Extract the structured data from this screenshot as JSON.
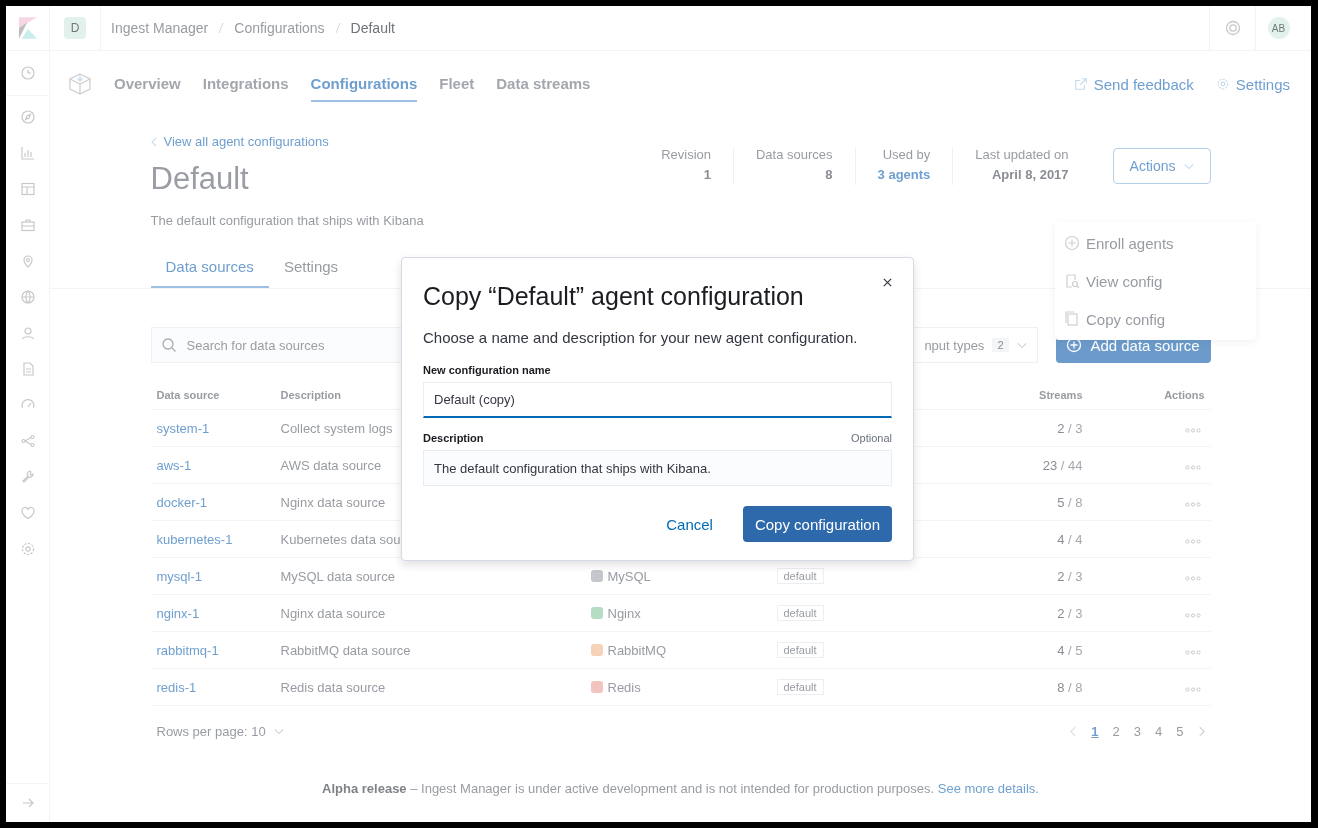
{
  "header": {
    "space_avatar": "D",
    "breadcrumbs": [
      {
        "label": "Ingest Manager",
        "selected": false
      },
      {
        "label": "Configurations",
        "selected": false
      },
      {
        "label": "Default",
        "selected": true
      }
    ],
    "user_avatar": "AB"
  },
  "app_nav": {
    "tabs": [
      {
        "label": "Overview",
        "selected": false
      },
      {
        "label": "Integrations",
        "selected": false
      },
      {
        "label": "Configurations",
        "selected": true
      },
      {
        "label": "Fleet",
        "selected": false
      },
      {
        "label": "Data streams",
        "selected": false
      }
    ],
    "send_feedback": "Send feedback",
    "settings": "Settings"
  },
  "page": {
    "back_link": "View all agent configurations",
    "title": "Default",
    "description": "The default configuration that ships with Kibana",
    "stats": [
      {
        "label": "Revision",
        "value": "1",
        "kind": "text"
      },
      {
        "label": "Data sources",
        "value": "8",
        "kind": "text"
      },
      {
        "label": "Used by",
        "value": "3 agents",
        "kind": "link"
      },
      {
        "label": "Last updated on",
        "value": "April 8, 2017",
        "kind": "text"
      }
    ],
    "actions_button": "Actions",
    "tabs": [
      {
        "label": "Data sources",
        "selected": true
      },
      {
        "label": "Settings",
        "selected": false
      }
    ]
  },
  "toolbar": {
    "search_placeholder": "Search for data sources",
    "filter_label": "nput types",
    "filter_count": "2",
    "add_button": "Add data source"
  },
  "table": {
    "columns": [
      "Data source",
      "Description",
      "Streams",
      "Actions"
    ],
    "rows": [
      {
        "name": "system-1",
        "description": "Collect system logs",
        "streams": "2",
        "streams_total": "/ 3"
      },
      {
        "name": "aws-1",
        "description": "AWS data source",
        "streams": "23",
        "streams_total": "/ 44"
      },
      {
        "name": "docker-1",
        "description": "Nginx data source",
        "streams": "5",
        "streams_total": "/ 8"
      },
      {
        "name": "kubernetes-1",
        "description": "Kubernetes data sou",
        "streams": "4",
        "streams_total": "/ 4"
      },
      {
        "name": "mysql-1",
        "description": "MySQL data source",
        "integration": {
          "label": "MySQL",
          "color": "#c4c8cc"
        },
        "namespace": "default",
        "streams": "2",
        "streams_total": "/ 3"
      },
      {
        "name": "nginx-1",
        "description": "Nginx data source",
        "integration": {
          "label": "Nginx",
          "color": "#b5dcc4"
        },
        "namespace": "default",
        "streams": "2",
        "streams_total": "/ 3"
      },
      {
        "name": "rabbitmq-1",
        "description": "RabbitMQ data source",
        "integration": {
          "label": "RabbitMQ",
          "color": "#f8d2b8"
        },
        "namespace": "default",
        "streams": "4",
        "streams_total": "/ 5"
      },
      {
        "name": "redis-1",
        "description": "Redis data source",
        "integration": {
          "label": "Redis",
          "color": "#f2c4c0"
        },
        "namespace": "default",
        "streams": "8",
        "streams_total": "/ 8"
      }
    ]
  },
  "pagination": {
    "rows_per_page": "Rows per page: 10",
    "pages": [
      {
        "label": "1",
        "selected": true
      },
      {
        "label": "2",
        "selected": false
      },
      {
        "label": "3",
        "selected": false
      },
      {
        "label": "4",
        "selected": false
      },
      {
        "label": "5",
        "selected": false
      }
    ]
  },
  "footer": {
    "text": "**Alpha release** – Ingest Manager is under active development and is not intended for production purposes.",
    "link": "See more details."
  },
  "actions_menu": {
    "items": [
      {
        "label": "Enroll agents",
        "kind": "enroll"
      },
      {
        "label": "View config",
        "kind": "view"
      },
      {
        "label": "Copy config",
        "kind": "copy"
      }
    ]
  },
  "modal": {
    "title": "Copy “Default” agent configuration",
    "subtitle": "Choose a name and description for your new agent configuration.",
    "name_label": "New configuration name",
    "name_value": "Default (copy)",
    "description_label": "Description",
    "optional": "Optional",
    "description_value": "The default configuration that ships with Kibana.",
    "cancel": "Cancel",
    "confirm": "Copy configuration"
  }
}
